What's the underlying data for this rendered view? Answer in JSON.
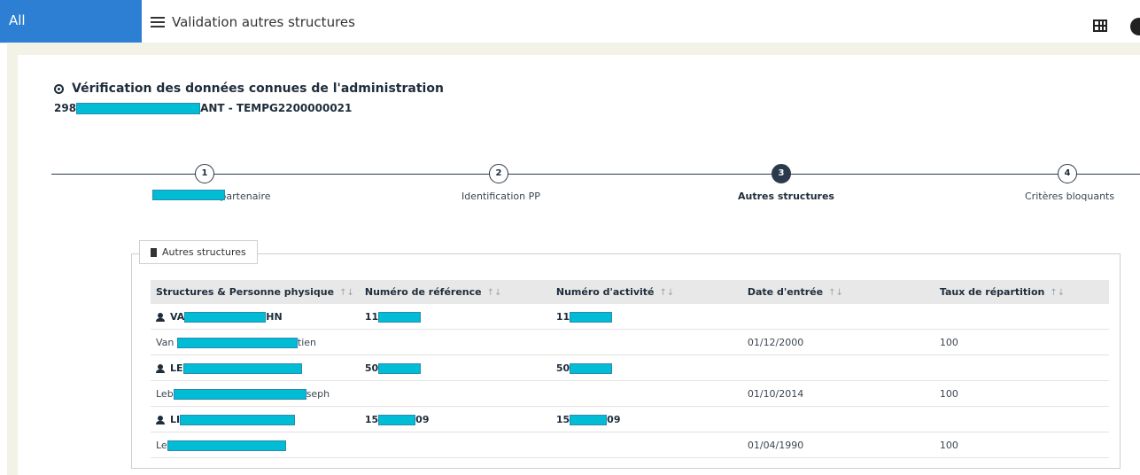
{
  "topbar": {
    "all_label": "All",
    "menu_title": "Validation autres structures",
    "grid_icon": "grid-icon",
    "avatar": "user-avatar-icon"
  },
  "header": {
    "title": "Vérification des données connues de l'administration",
    "subtitle_prefix": "298",
    "subtitle_suffix": "ANT - TEMPG2200000021"
  },
  "stepper": {
    "steps": [
      {
        "number": "1",
        "label": "…entification partenaire",
        "active": false
      },
      {
        "number": "2",
        "label": "Identification PP",
        "active": false
      },
      {
        "number": "3",
        "label": "Autres structures",
        "active": true
      },
      {
        "number": "4",
        "label": "Critères bloquants",
        "active": false
      }
    ]
  },
  "panel": {
    "tab_label": "Autres structures"
  },
  "table": {
    "columns": [
      "Structures & Personne physique",
      "Numéro de référence",
      "Numéro d'activité",
      "Date d'entrée",
      "Taux de répartition"
    ],
    "rows": [
      {
        "type": "group",
        "name_prefix": "VA",
        "name_suffix": "HN",
        "ref_prefix": "11",
        "ref_suffix": "",
        "act_prefix": "11",
        "act_suffix": "",
        "date": "",
        "taux": ""
      },
      {
        "type": "person",
        "name_prefix": "Van",
        "name_suffix": "tien",
        "ref_prefix": "",
        "ref_suffix": "",
        "act_prefix": "",
        "act_suffix": "",
        "date": "01/12/2000",
        "taux": "100"
      },
      {
        "type": "group",
        "name_prefix": "LE",
        "name_suffix": "",
        "ref_prefix": "50",
        "ref_suffix": "",
        "act_prefix": "50",
        "act_suffix": "",
        "date": "",
        "taux": ""
      },
      {
        "type": "person",
        "name_prefix": "Leb",
        "name_suffix": "seph",
        "ref_prefix": "",
        "ref_suffix": "",
        "act_prefix": "",
        "act_suffix": "",
        "date": "01/10/2014",
        "taux": "100"
      },
      {
        "type": "group",
        "name_prefix": "LI",
        "name_suffix": "",
        "ref_prefix": "15",
        "ref_suffix": "09",
        "act_prefix": "15",
        "act_suffix": "09",
        "date": "",
        "taux": ""
      },
      {
        "type": "person",
        "name_prefix": "Le",
        "name_suffix": "",
        "ref_prefix": "",
        "ref_suffix": "",
        "act_prefix": "",
        "act_suffix": "",
        "date": "01/04/1990",
        "taux": "100"
      }
    ]
  },
  "colors": {
    "accent": "#2d7fd4",
    "dark": "#2b3a4a",
    "redaction": "#00bcd4",
    "frame_bg": "#f2f2e6"
  }
}
